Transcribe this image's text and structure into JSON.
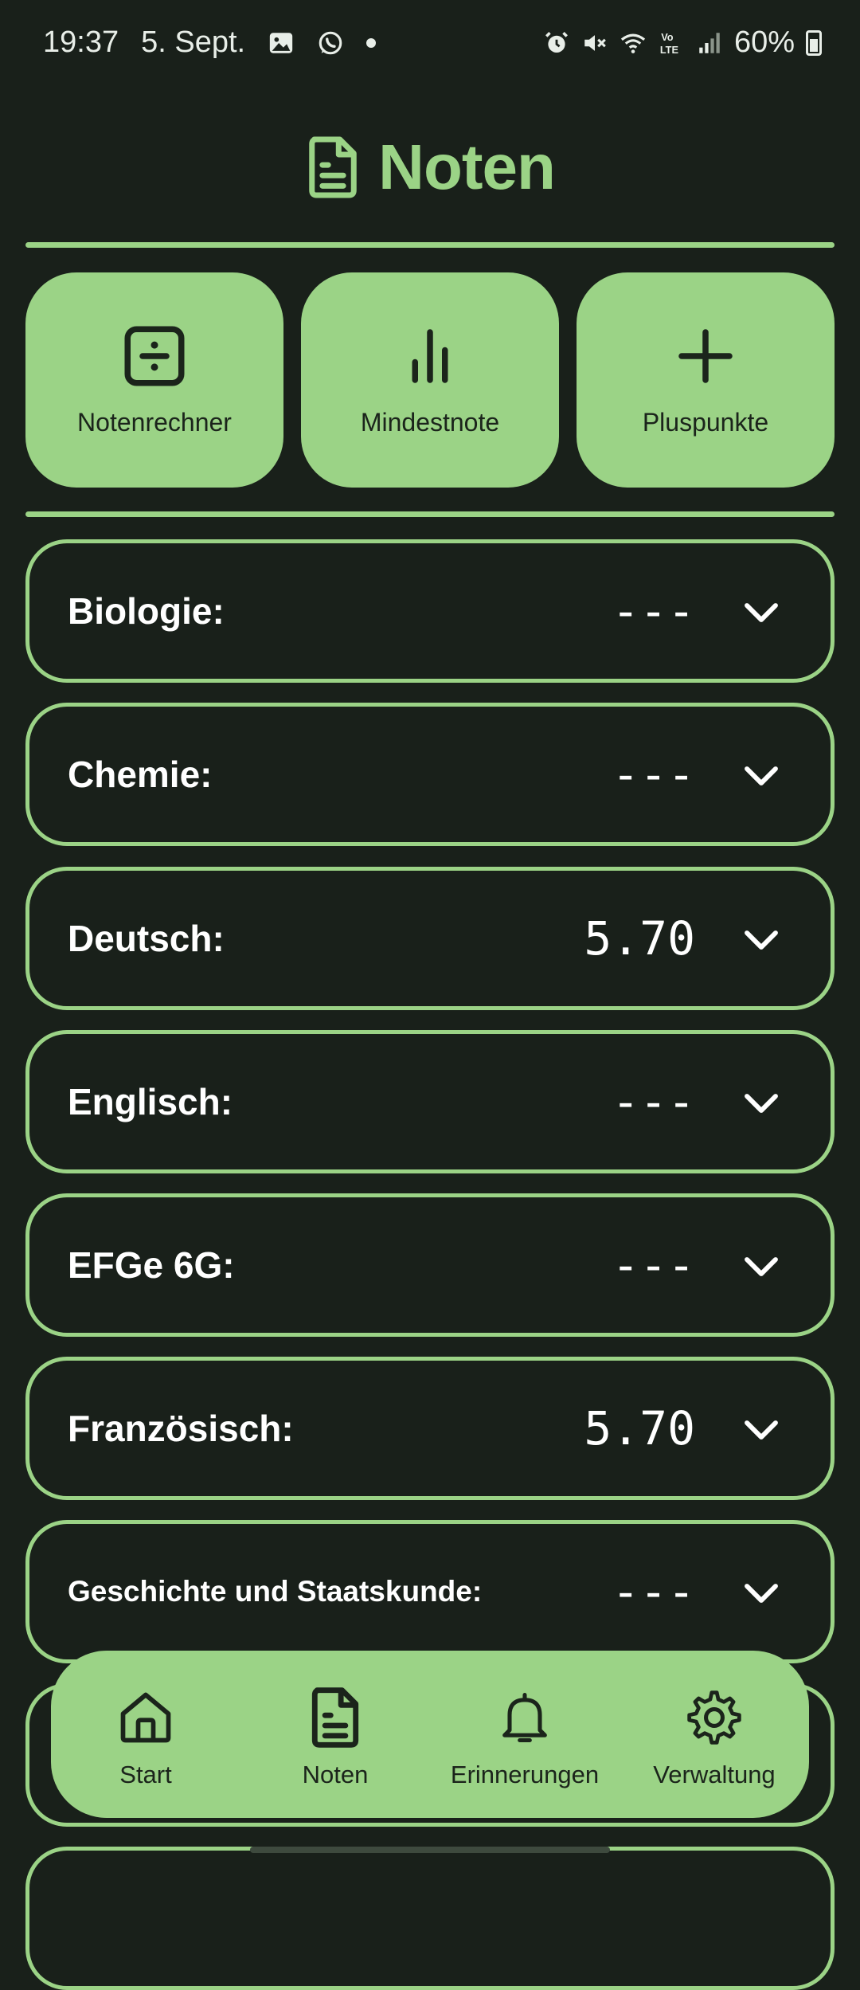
{
  "status_bar": {
    "time": "19:37",
    "date": "5. Sept.",
    "battery": "60%",
    "left_icons": [
      "image-icon",
      "whatsapp-icon"
    ],
    "right_icons": [
      "alarm-icon",
      "mute-icon",
      "wifi-icon",
      "volte-icon",
      "signal-icon",
      "battery-icon"
    ]
  },
  "header": {
    "title": "Noten",
    "icon": "document-icon"
  },
  "quick_actions": [
    {
      "label": "Notenrechner",
      "icon": "calculator-divide-icon"
    },
    {
      "label": "Mindestnote",
      "icon": "bar-chart-icon"
    },
    {
      "label": "Pluspunkte",
      "icon": "plus-icon"
    }
  ],
  "subjects": [
    {
      "name": "Biologie:",
      "grade": "---"
    },
    {
      "name": "Chemie:",
      "grade": "---"
    },
    {
      "name": "Deutsch:",
      "grade": "5.70"
    },
    {
      "name": "Englisch:",
      "grade": "---"
    },
    {
      "name": "EFGe 6G:",
      "grade": "---"
    },
    {
      "name": "Französisch:",
      "grade": "5.70"
    },
    {
      "name": "Geschichte und Staatskunde:",
      "grade": "---"
    }
  ],
  "nav": [
    {
      "label": "Start",
      "icon": "home-icon"
    },
    {
      "label": "Noten",
      "icon": "document-icon"
    },
    {
      "label": "Erinnerungen",
      "icon": "bell-icon"
    },
    {
      "label": "Verwaltung",
      "icon": "gear-icon"
    }
  ],
  "colors": {
    "background": "#19201a",
    "accent": "#9bd386",
    "text": "#ffffff",
    "on_accent": "#1b241b"
  }
}
